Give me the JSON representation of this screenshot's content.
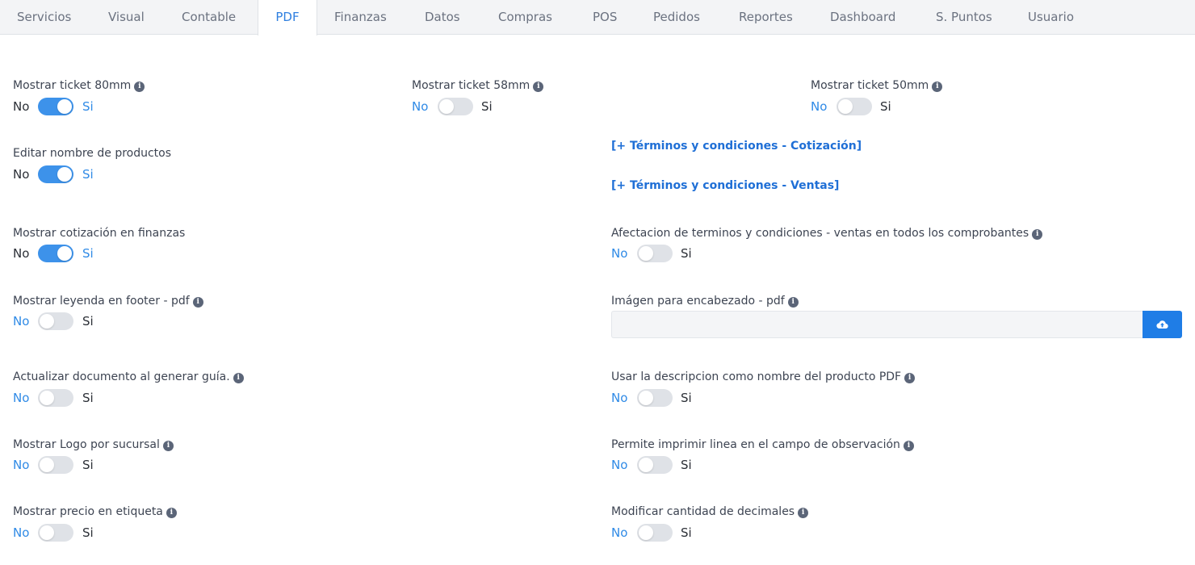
{
  "tabs": [
    {
      "label": "Servicios"
    },
    {
      "label": "Visual"
    },
    {
      "label": "Contable"
    },
    {
      "label": "PDF",
      "active": true
    },
    {
      "label": "Finanzas"
    },
    {
      "label": "Datos"
    },
    {
      "label": "Compras"
    },
    {
      "label": "POS"
    },
    {
      "label": "Pedidos"
    },
    {
      "label": "Reportes"
    },
    {
      "label": "Dashboard"
    },
    {
      "label": "S. Puntos"
    },
    {
      "label": "Usuario"
    }
  ],
  "toggle_labels": {
    "no": "No",
    "yes": "Si"
  },
  "settings": {
    "ticket_80mm": {
      "label": "Mostrar ticket 80mm",
      "enabled": true
    },
    "ticket_58mm": {
      "label": "Mostrar ticket 58mm",
      "enabled": false
    },
    "ticket_50mm": {
      "label": "Mostrar ticket 50mm",
      "enabled": false
    },
    "edit_product_name": {
      "label": "Editar nombre de productos",
      "enabled": true
    },
    "quote_in_finance": {
      "label": "Mostrar cotización en finanzas",
      "enabled": true
    },
    "footer_legend": {
      "label": "Mostrar leyenda en footer - pdf",
      "enabled": false
    },
    "update_doc_on_guide": {
      "label": "Actualizar documento al generar guía.",
      "enabled": false
    },
    "logo_per_branch": {
      "label": "Mostrar Logo por sucursal",
      "enabled": false
    },
    "price_on_label": {
      "label": "Mostrar precio en etiqueta",
      "enabled": false
    },
    "terms_all_receipts": {
      "label": "Afectacion de terminos y condiciones - ventas en todos los comprobantes",
      "enabled": false
    },
    "description_as_name": {
      "label": "Usar la descripcion como nombre del producto PDF",
      "enabled": false
    },
    "print_line_observation": {
      "label": "Permite imprimir linea en el campo de observación",
      "enabled": false
    },
    "modify_decimals": {
      "label": "Modificar cantidad de decimales",
      "enabled": false
    }
  },
  "links": {
    "terms_quote": "[+ Términos y condiciones - Cotización]",
    "terms_sales": "[+ Términos y condiciones - Ventas]"
  },
  "header_image": {
    "label": "Imágen para encabezado - pdf",
    "value": ""
  },
  "icons": {
    "info": "info-icon",
    "upload": "cloud-upload-icon"
  },
  "colors": {
    "accent": "#2f7fe0",
    "toggle_on": "#3d92ea",
    "button": "#1f7de6",
    "link": "#1f6fd6"
  }
}
